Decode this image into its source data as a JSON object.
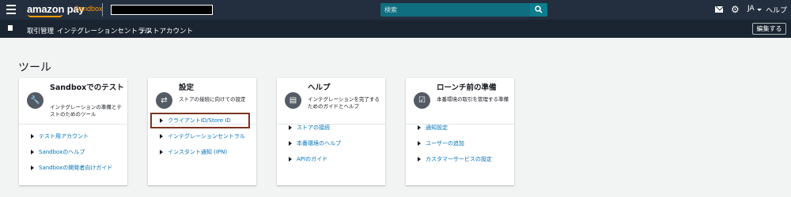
{
  "header": {
    "logo": "amazon pay",
    "environment": "Sandbox",
    "search_placeholder": "検索",
    "language": "JA",
    "help": "ヘルプ"
  },
  "subnav": {
    "items": [
      "取引管理",
      "インテグレーションセントラル",
      "テストアカウント"
    ],
    "edit_button": "編集する"
  },
  "page": {
    "title": "ツール"
  },
  "cards": [
    {
      "title": "Sandboxでのテスト",
      "description": "インテグレーションの準備とテストのためのツール",
      "icon": "wrench-icon",
      "links": [
        "テスト用アカウント",
        "Sandboxのヘルプ",
        "Sandboxの開発者向けガイド"
      ]
    },
    {
      "title": "設定",
      "description": "ストアの接続に向けての設定",
      "icon": "arrows-icon",
      "links": [
        "クライアントID/Store ID",
        "インテグレーションセントラル",
        "インスタント通知 (IPN)"
      ]
    },
    {
      "title": "ヘルプ",
      "description": "インテグレーションを完了するためのガイドとヘルプ",
      "icon": "document-icon",
      "links": [
        "ストアの接続",
        "本番環境のヘルプ",
        "APIのガイド"
      ]
    },
    {
      "title": "ローンチ前の準備",
      "description": "本番環境の取引を管理する準備",
      "icon": "checklist-icon",
      "links": [
        "通知設定",
        "ユーザーの追加",
        "カスタマーサービスの設定"
      ]
    }
  ],
  "colors": {
    "header_bg": "#232f3e",
    "subnav_bg": "#1b2532",
    "accent": "#ff9900",
    "link": "#0073bb",
    "highlight_border": "#7c3420"
  }
}
